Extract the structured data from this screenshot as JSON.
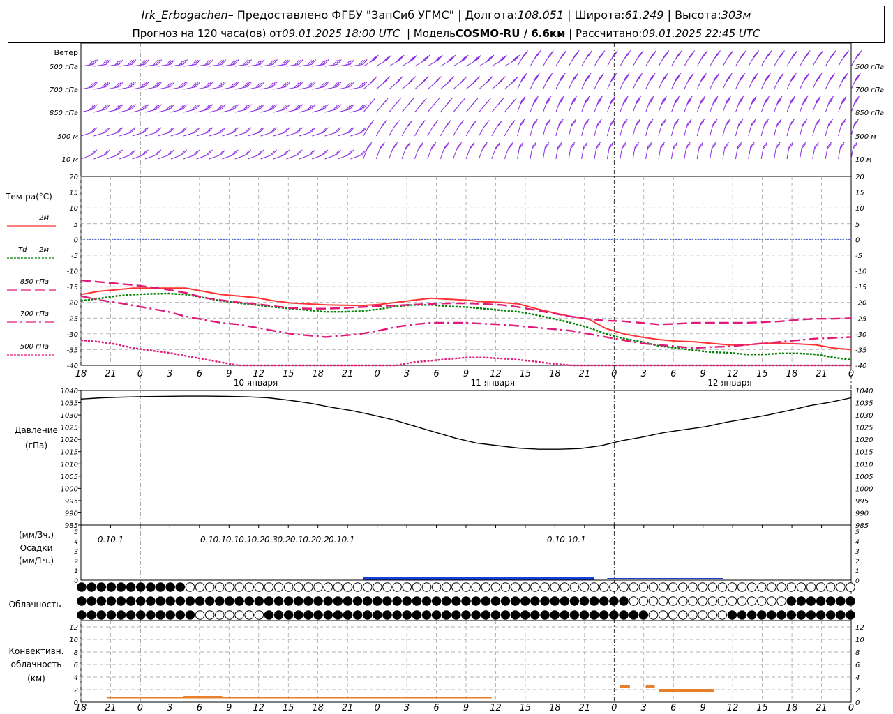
{
  "header": {
    "station": "Irk_Erbogachen",
    "provider": "– Предоставлено ФГБУ \"ЗапСиб УГМС\"",
    "lon_label": "Долгота:",
    "lon": "108.051",
    "lat_label": "Широта:",
    "lat": "61.249",
    "alt_label": "Высота:",
    "alt": "303м",
    "forecast_label": "Прогноз на 120 часа(ов) от",
    "forecast_time": "09.01.2025 18:00 UTC",
    "model_label": "Модель",
    "model": "COSMO-RU / 6.6км",
    "calc_label": "Рассчитано:",
    "calc_time": "09.01.2025 22:45 UTC"
  },
  "chart_data": [
    {
      "type": "wind_barbs",
      "title": "Ветер",
      "levels": [
        "500 гПа",
        "700 гПа",
        "850 гПа",
        "500 м",
        "10 м"
      ],
      "color": "#8a2be2"
    },
    {
      "type": "line",
      "ylabel": "Тем-ра(°C)",
      "ylim": [
        -40,
        20
      ],
      "yticks": [
        20,
        15,
        10,
        5,
        0,
        -5,
        -10,
        -15,
        -20,
        -25,
        -30,
        -35,
        -40
      ],
      "x_hours": [
        0,
        3,
        6,
        9,
        12,
        15,
        18,
        21,
        24,
        27,
        30,
        33,
        36,
        39,
        42,
        45,
        48,
        51,
        54,
        57,
        60,
        63,
        66,
        69,
        72,
        75,
        78,
        81,
        84,
        87,
        90,
        93,
        96,
        99,
        102,
        105,
        108,
        111,
        114,
        117,
        120,
        123,
        126,
        129,
        132,
        135,
        138,
        141,
        144,
        147,
        150,
        153,
        156,
        159,
        162,
        165,
        168,
        171,
        174,
        177,
        180
      ],
      "series": [
        {
          "name": "2м",
          "color": "#ff3333",
          "dash": "solid",
          "values": [
            -17.5,
            -16.5,
            -16,
            -15.5,
            -15.5,
            -15.5,
            -15.5,
            -16.5,
            -17.5,
            -18,
            -18.5,
            -19.5,
            -20.2,
            -20.5,
            -20.8,
            -20.9,
            -21,
            -20.7,
            -20,
            -19.3,
            -18.7,
            -19,
            -19.3,
            -19.8,
            -20,
            -20.5,
            -22,
            -23.3,
            -24.5,
            -25.3,
            -28.3,
            -30,
            -31,
            -31.8,
            -32.3,
            -32.5,
            -33,
            -33.5,
            -33.5,
            -33,
            -33,
            -33.2,
            -33.5,
            -34.5,
            -35
          ]
        },
        {
          "name": "Td 2м",
          "color": "#008000",
          "dash": "dotted",
          "values": [
            -19.5,
            -18.8,
            -18,
            -17.5,
            -17.3,
            -17.2,
            -17.5,
            -18.5,
            -19.5,
            -20.2,
            -20.8,
            -21.5,
            -22,
            -22.5,
            -23,
            -23,
            -22.8,
            -22.2,
            -21.3,
            -20.8,
            -20.8,
            -21.3,
            -21.5,
            -22,
            -22.5,
            -23,
            -24,
            -25.2,
            -26.5,
            -28,
            -30,
            -31.5,
            -32.5,
            -33.8,
            -34.5,
            -35.2,
            -35.8,
            -36,
            -36.5,
            -36.5,
            -36.2,
            -36.2,
            -36.5,
            -37.5,
            -38.2
          ]
        },
        {
          "name": "850 гПа",
          "color": "#e0197b",
          "dash": "dash",
          "values": [
            -13,
            -13.5,
            -14,
            -14.5,
            -15.2,
            -16,
            -17,
            -18.5,
            -19.3,
            -20,
            -20.5,
            -21.2,
            -21.8,
            -22,
            -22,
            -21.8,
            -21.5,
            -21.2,
            -21,
            -20.7,
            -20.5,
            -20.3,
            -20.3,
            -20.5,
            -20.8,
            -21.5,
            -22.5,
            -23.5,
            -24.5,
            -25.3,
            -25.8,
            -26,
            -26.5,
            -27,
            -26.8,
            -26.5,
            -26.5,
            -26.5,
            -26.5,
            -26.3,
            -26,
            -25.5,
            -25.2,
            -25.2,
            -25
          ]
        },
        {
          "name": "700 гПа",
          "color": "#e0197b",
          "dash": "dashdot",
          "values": [
            -18,
            -19.2,
            -20,
            -21,
            -22,
            -23,
            -24.5,
            -25.5,
            -26.5,
            -27,
            -28,
            -29,
            -30,
            -30.5,
            -31,
            -30.5,
            -30,
            -29,
            -27.8,
            -27,
            -26.5,
            -26.5,
            -26.5,
            -26.8,
            -27,
            -27.5,
            -28,
            -28.5,
            -29,
            -30,
            -31,
            -32,
            -33,
            -33.5,
            -34,
            -34.5,
            -34.2,
            -34,
            -33.5,
            -33,
            -32.5,
            -32,
            -31.5,
            -31.3,
            -31
          ]
        },
        {
          "name": "500 гПа",
          "color": "#e0197b",
          "dash": "dotted",
          "values": [
            -32,
            -32.5,
            -33.3,
            -34.5,
            -35.3,
            -36,
            -37,
            -38,
            -39,
            -40,
            -41,
            -41,
            -41,
            -41,
            -41,
            -41,
            -41,
            -41,
            -40,
            -39,
            -38.5,
            -38,
            -37.5,
            -37.5,
            -37.8,
            -38.2,
            -38.8,
            -39.5,
            -40.5,
            -41,
            -41,
            -41,
            -41,
            -41,
            -41,
            -41,
            -41,
            -41,
            -41,
            -41,
            -41,
            -41,
            -41,
            -41,
            -41
          ]
        }
      ]
    },
    {
      "type": "line",
      "ylabel": "Давление",
      "yunit": "(гПа)",
      "ylim": [
        985,
        1040
      ],
      "yticks": [
        1040,
        1035,
        1030,
        1025,
        1020,
        1015,
        1010,
        1005,
        1000,
        995,
        990,
        985
      ],
      "series": [
        {
          "name": "pressure",
          "color": "#000000",
          "values": [
            1036.5,
            1037,
            1037.3,
            1037.5,
            1037.6,
            1037.7,
            1037.7,
            1037.6,
            1037.4,
            1037,
            1036,
            1034.8,
            1033.2,
            1031.8,
            1030,
            1028,
            1025.5,
            1023,
            1020.5,
            1018.5,
            1017.5,
            1016.5,
            1016,
            1016,
            1016.3,
            1017.5,
            1019.5,
            1021,
            1022.8,
            1024,
            1025.2,
            1027,
            1028.5,
            1030,
            1031.8,
            1033.8,
            1035.2,
            1037
          ]
        }
      ]
    },
    {
      "type": "bar",
      "ylabel": "(мм/3ч.)",
      "title": "Осадки",
      "yunit": "(мм/1ч.)",
      "ylim": [
        0,
        5
      ],
      "yticks": [
        5,
        4,
        3,
        2,
        1,
        0
      ],
      "labels": [
        {
          "hour": 3,
          "text": "0.1"
        },
        {
          "hour": 6,
          "text": "0.1"
        },
        {
          "hour": 27,
          "text": "0.1"
        },
        {
          "hour": 30,
          "text": "0.1"
        },
        {
          "hour": 33,
          "text": "0.1"
        },
        {
          "hour": 36,
          "text": "0.1"
        },
        {
          "hour": 39,
          "text": "0.2"
        },
        {
          "hour": 42,
          "text": "0.3"
        },
        {
          "hour": 45,
          "text": "0.2"
        },
        {
          "hour": 48,
          "text": "0.1"
        },
        {
          "hour": 51,
          "text": "0.2"
        },
        {
          "hour": 54,
          "text": "0.2"
        },
        {
          "hour": 57,
          "text": "0.1"
        },
        {
          "hour": 60,
          "text": "0.1"
        },
        {
          "hour": 108,
          "text": "0.1"
        },
        {
          "hour": 111,
          "text": "0.1"
        },
        {
          "hour": 114,
          "text": "0.1"
        }
      ],
      "color": "#1a3fd6"
    },
    {
      "type": "symbols",
      "title": "Облачность",
      "rows": 3
    },
    {
      "type": "bar",
      "ylabel": "Конвективн. облачность (км)",
      "ylim": [
        0,
        13
      ],
      "yticks": [
        12,
        10,
        8,
        6,
        4,
        2,
        0
      ],
      "color": "#e87f2a"
    }
  ],
  "x_axis": {
    "tick_labels": [
      "18",
      "21",
      "0",
      "3",
      "6",
      "9",
      "12",
      "15",
      "18",
      "21",
      "0",
      "3",
      "6",
      "9",
      "12",
      "15",
      "18",
      "21",
      "0",
      "3",
      "6",
      "9",
      "12",
      "15",
      "18",
      "21",
      "0"
    ],
    "dates": [
      "10 января",
      "11 января",
      "12 января"
    ]
  },
  "temp_legend": {
    "title": "Тем-ра(°C)",
    "l2m": "2м",
    "td": "Td",
    "td2m": "2м",
    "p850": "850 гПа",
    "p700": "700 гПа",
    "p500": "500 гПа"
  },
  "wind_labels": [
    "Ветер",
    "500 гПа",
    "700 гПа",
    "850 гПа",
    "500 м",
    "10 м"
  ],
  "wind_right_labels": [
    "500 гПа",
    "700 гПа",
    "850 гПа",
    "500 м",
    "10 м"
  ],
  "pressure_labels": {
    "title": "Давление",
    "unit": "(гПа)"
  },
  "precip_labels": {
    "l1": "(мм/3ч.)",
    "l2": "Осадки",
    "l3": "(мм/1ч.)"
  },
  "cloud_label": "Облачность",
  "conv_labels": {
    "l1": "Конвективн.",
    "l2": "облачность",
    "l3": "(км)"
  }
}
